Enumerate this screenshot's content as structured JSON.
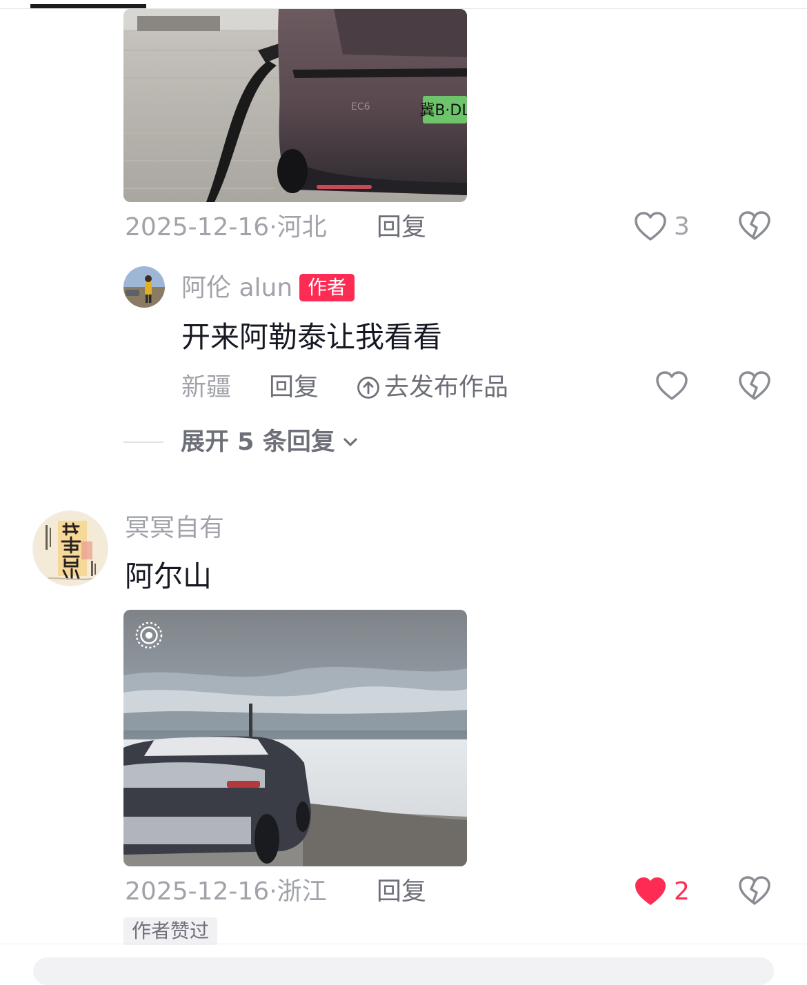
{
  "comments": [
    {
      "date": "2025-12-16",
      "location": "河北",
      "reply_label": "回复",
      "like_count": "3",
      "liked": false
    },
    {
      "username": "冥冥自有",
      "text": "阿尔山",
      "date": "2025-12-16",
      "location": "浙江",
      "reply_label": "回复",
      "like_count": "2",
      "liked": true,
      "author_liked_tag": "作者赞过"
    }
  ],
  "author_reply": {
    "username": "阿伦 alun",
    "badge": "作者",
    "text": "开来阿勒泰让我看看",
    "location": "新疆",
    "reply_label": "回复",
    "publish_label": "去发布作品"
  },
  "expand_replies": {
    "label": "展开 5 条回复"
  },
  "photo1": {
    "plate_text": "冀B·DL",
    "badge_text": "EC6"
  },
  "colors": {
    "accent": "#fe2c55",
    "muted": "#a1a3aa",
    "text": "#161823"
  },
  "icons": [
    "heart-icon",
    "broken-heart-icon",
    "chevron-down-icon",
    "upload-icon",
    "live-photo-icon"
  ]
}
